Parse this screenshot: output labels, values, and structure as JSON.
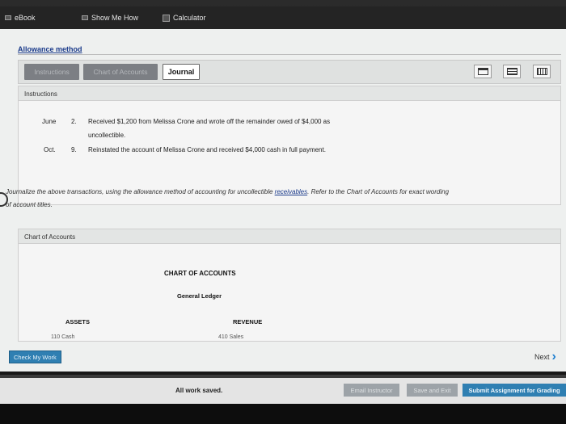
{
  "topbar": {
    "ebook_label": "eBook",
    "show_me_how_label": "Show Me How",
    "calculator_label": "Calculator"
  },
  "page_title": "Allowance method",
  "tabs": [
    {
      "label": "Instructions"
    },
    {
      "label": "Chart of Accounts"
    },
    {
      "label": "Journal"
    }
  ],
  "toolbar_icons": [
    "print-icon",
    "layout-icon",
    "grid-icon"
  ],
  "instructions": {
    "header": "Instructions",
    "rows": [
      {
        "month": "June",
        "day": "2.",
        "text_line1": "Received $1,200 from Melissa Crone and wrote off the remainder owed of $4,000 as",
        "text_line2": "uncollectible."
      },
      {
        "month": "Oct.",
        "day": "9.",
        "text_line1": "Reinstated the account of Melissa Crone and received $4,000 cash in full payment.",
        "text_line2": ""
      }
    ],
    "intro_before_link": "Journalize the above transactions, using the allowance method of accounting for uncollectible ",
    "intro_link": "receivables",
    "intro_after_link": ". Refer to the Chart of Accounts for exact wording",
    "intro_line2": "of account titles."
  },
  "chart_of_accounts": {
    "header": "Chart of Accounts",
    "title": "CHART OF ACCOUNTS",
    "subtitle": "General Ledger",
    "assets_heading": "ASSETS",
    "revenue_heading": "REVENUE",
    "asset_first": "110  Cash",
    "revenue_first": "410  Sales"
  },
  "footer": {
    "check_label": "Check My Work",
    "next_label": "Next",
    "saved_label": "All work saved.",
    "email_label": "Email Instructor",
    "save_exit_label": "Save and Exit",
    "submit_label": "Submit Assignment for Grading"
  },
  "colors": {
    "accent_blue": "#2f7fb2",
    "link_blue": "#1a3a8a",
    "dim_tab": "#7c7f84"
  }
}
